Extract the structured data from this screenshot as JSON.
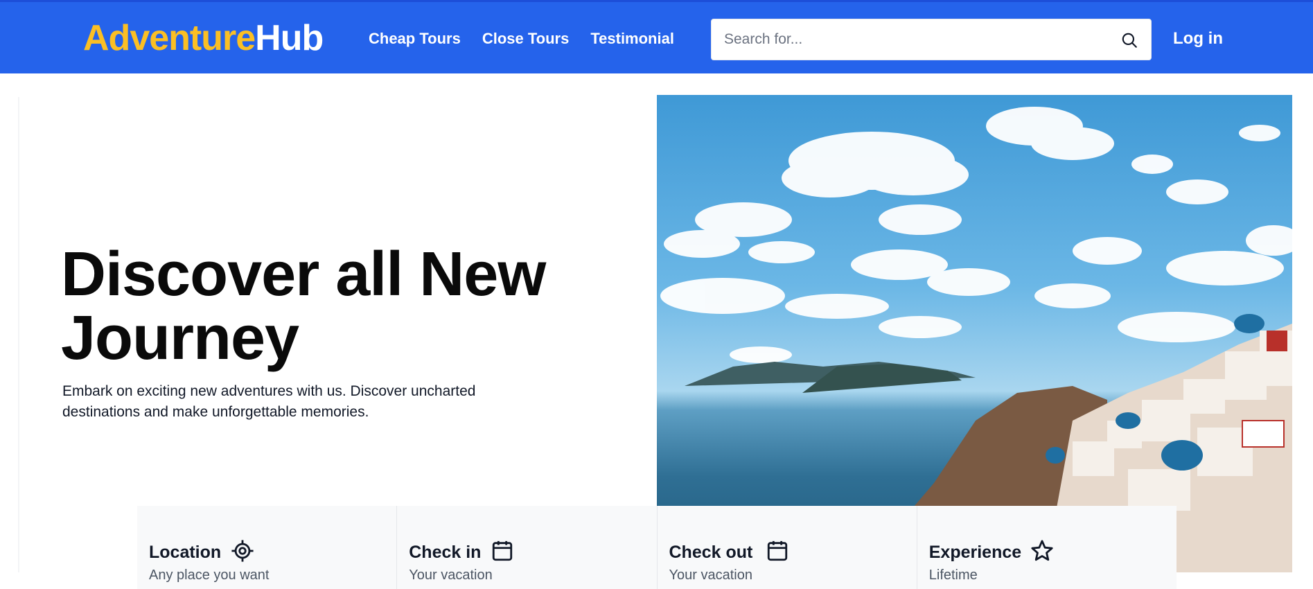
{
  "header": {
    "logo_part1": "Adventure",
    "logo_part2": "Hub",
    "nav": [
      "Cheap Tours",
      "Close Tours",
      "Testimonial"
    ],
    "search_placeholder": "Search for...",
    "login": "Log in",
    "colors": {
      "bar": "#2563eb",
      "logo_accent": "#fbbf24"
    }
  },
  "hero": {
    "title_line1": "Discover all New",
    "title_line2": "Journey",
    "subtitle": "Embark on exciting new adventures with us. Discover uncharted destinations and make unforgettable memories."
  },
  "booking": [
    {
      "label": "Location",
      "icon": "location-target-icon",
      "sub": "Any place you want"
    },
    {
      "label": "Check in",
      "icon": "calendar-icon",
      "sub": "Your vacation"
    },
    {
      "label": "Check out",
      "icon": "calendar-icon",
      "sub": "Your vacation"
    },
    {
      "label": "Experience",
      "icon": "star-icon",
      "sub": "Lifetime"
    }
  ]
}
